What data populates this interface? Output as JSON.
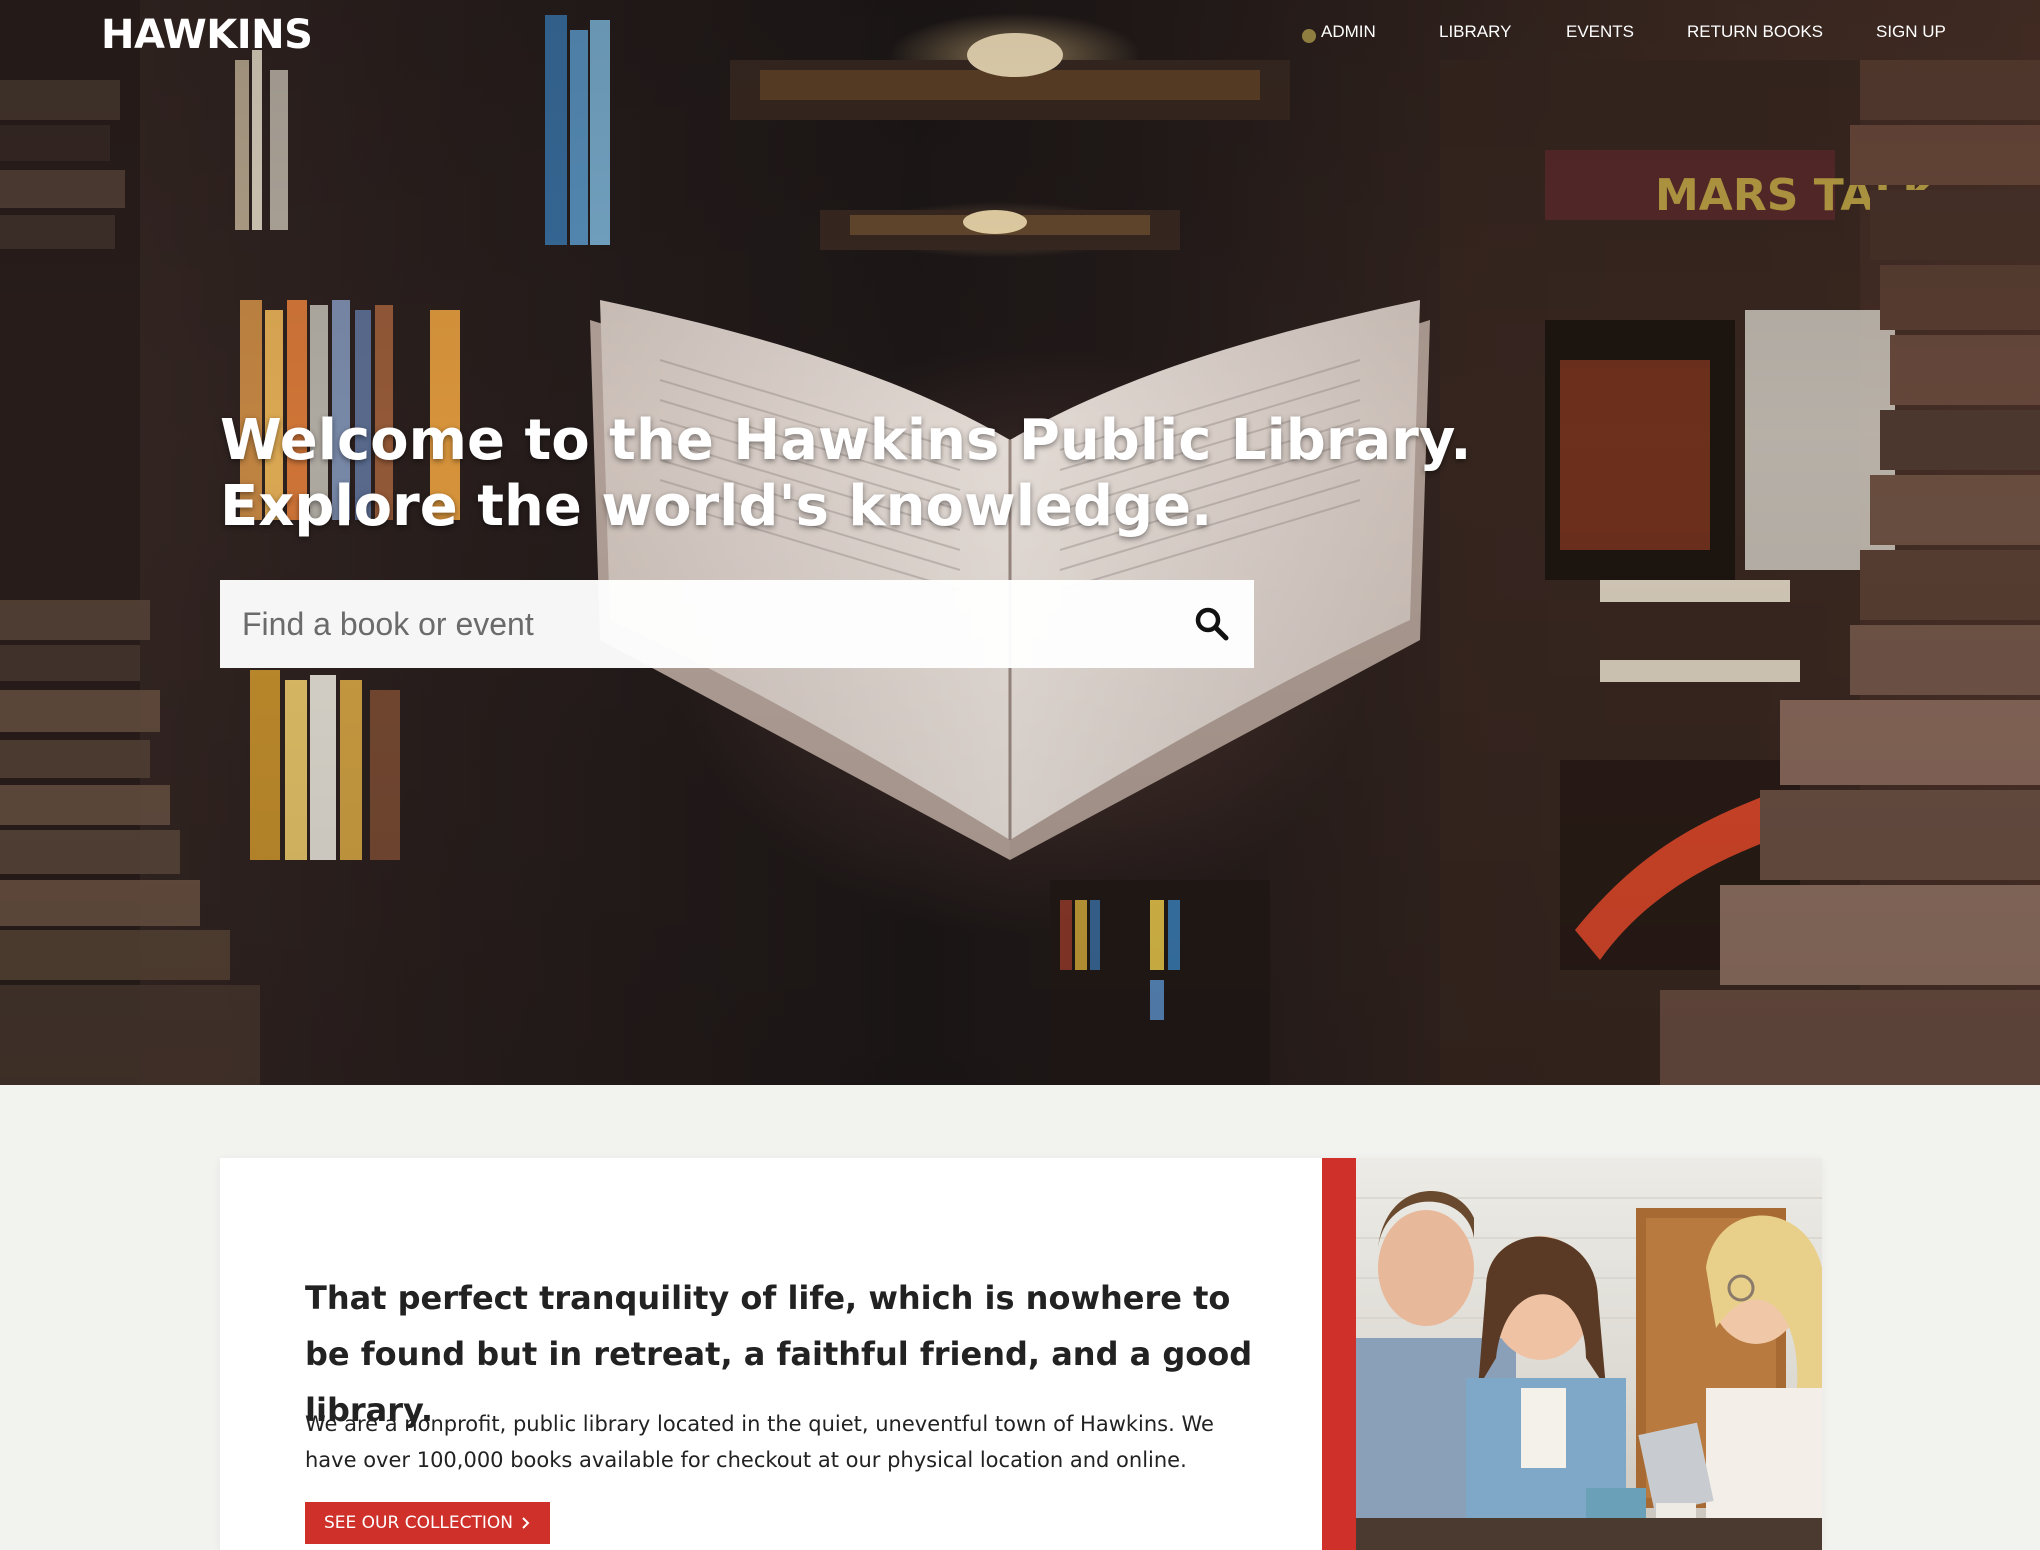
{
  "brand": {
    "logo": "HAWKINS"
  },
  "nav": {
    "items": [
      {
        "label": "ADMIN"
      },
      {
        "label": "LIBRARY"
      },
      {
        "label": "EVENTS"
      },
      {
        "label": "RETURN BOOKS"
      },
      {
        "label": "SIGN UP"
      }
    ]
  },
  "hero": {
    "title": "Welcome to the Hawkins Public Library. Explore the world's knowledge.",
    "search": {
      "placeholder": "Find a book or event",
      "value": ""
    }
  },
  "about": {
    "quote": "That perfect tranquility of life, which is nowhere to be found but in retreat, a faithful friend, and a good library.",
    "description": "We are a nonprofit, public library located in the quiet, uneventful town of Hawkins. We have over 100,000 books available for checkout at our physical location and online.",
    "cta_label": "SEE OUR COLLECTION",
    "cta_icon": "chevron-right-icon"
  },
  "colors": {
    "accent": "#d0302a",
    "page_bg": "#f2f2ef",
    "text": "#222222"
  }
}
